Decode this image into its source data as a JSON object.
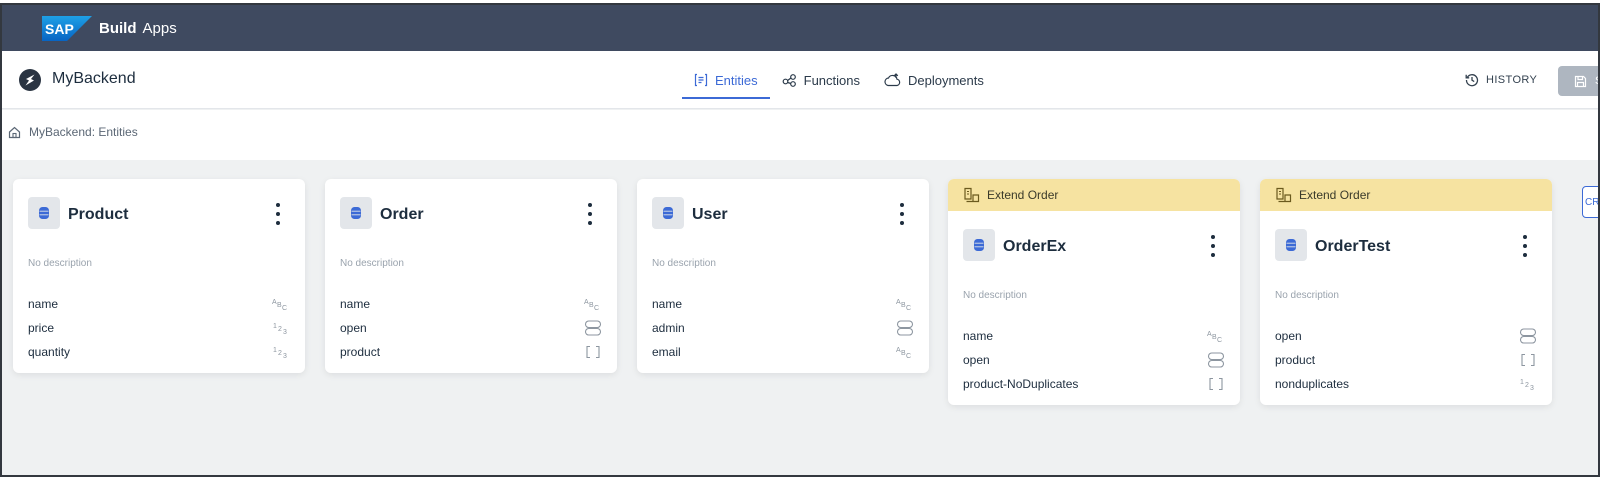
{
  "shell": {
    "logo_text": "SAP",
    "product_bold": "Build",
    "product_rest": "Apps"
  },
  "header": {
    "app_name": "MyBackend",
    "tabs": [
      {
        "label": "Entities",
        "icon": "entities-icon",
        "active": true
      },
      {
        "label": "Functions",
        "icon": "functions-icon",
        "active": false
      },
      {
        "label": "Deployments",
        "icon": "deployments-icon",
        "active": false
      }
    ],
    "history_label": "HISTORY",
    "save_label": "S"
  },
  "breadcrumb": {
    "text": "MyBackend: Entities"
  },
  "create_label": "CRE",
  "colors": {
    "accent": "#3c6ad6",
    "shell": "#3f4a60",
    "extend_band": "#f6e3a1",
    "canvas": "#eff1f2"
  },
  "cards": [
    {
      "name": "Product",
      "extend": "",
      "description": "No description",
      "fields": [
        {
          "name": "name",
          "type": "text"
        },
        {
          "name": "price",
          "type": "number"
        },
        {
          "name": "quantity",
          "type": "number"
        }
      ]
    },
    {
      "name": "Order",
      "extend": "",
      "description": "No description",
      "fields": [
        {
          "name": "name",
          "type": "text"
        },
        {
          "name": "open",
          "type": "boolean"
        },
        {
          "name": "product",
          "type": "array"
        }
      ]
    },
    {
      "name": "User",
      "extend": "",
      "description": "No description",
      "fields": [
        {
          "name": "name",
          "type": "text"
        },
        {
          "name": "admin",
          "type": "boolean"
        },
        {
          "name": "email",
          "type": "text"
        }
      ]
    },
    {
      "name": "OrderEx",
      "extend": "Extend Order",
      "description": "No description",
      "fields": [
        {
          "name": "name",
          "type": "text"
        },
        {
          "name": "open",
          "type": "boolean"
        },
        {
          "name": "product-NoDuplicates",
          "type": "array"
        }
      ]
    },
    {
      "name": "OrderTest",
      "extend": "Extend Order",
      "description": "No description",
      "fields": [
        {
          "name": "open",
          "type": "boolean"
        },
        {
          "name": "product",
          "type": "array"
        },
        {
          "name": "nonduplicates",
          "type": "number"
        }
      ]
    }
  ]
}
